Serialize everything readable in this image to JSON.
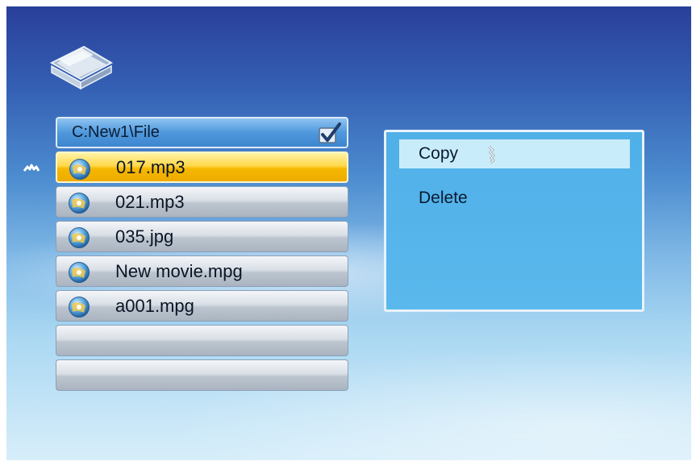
{
  "header": {
    "path": "C:New1\\File"
  },
  "file_list": {
    "items": [
      {
        "name": "017.mp3",
        "selected": true
      },
      {
        "name": "021.mp3",
        "selected": false
      },
      {
        "name": "035.jpg",
        "selected": false
      },
      {
        "name": "New movie.mpg",
        "selected": false
      },
      {
        "name": "a001.mpg",
        "selected": false
      },
      {
        "name": "",
        "selected": false
      },
      {
        "name": "",
        "selected": false
      }
    ]
  },
  "context_menu": {
    "items": [
      {
        "label": "Copy",
        "highlighted": true
      },
      {
        "label": "Delete",
        "highlighted": false
      }
    ]
  },
  "icons": {
    "folder": "folder-icon",
    "check": "checkmark-icon",
    "scroll_up": "scroll-up-icon",
    "file": "media-file-icon",
    "cursor": "hand-cursor-icon"
  },
  "colors": {
    "selection": "#ffd84a",
    "menu_background": "#55b4ea",
    "menu_highlight": "#c9ecfb"
  }
}
